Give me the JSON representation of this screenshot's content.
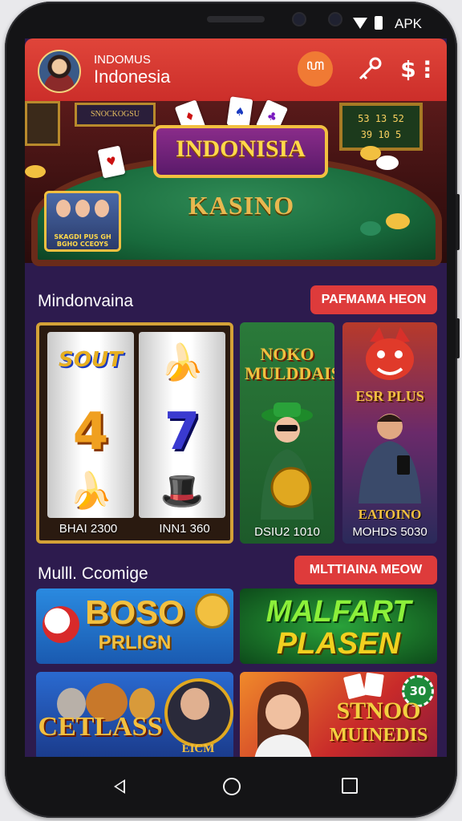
{
  "status_bar": {
    "label": "APK"
  },
  "header": {
    "brand_top": "INDOMUS",
    "brand_bottom": "Indonesia",
    "lang_icon": "ꦲ",
    "key_icon": "key-icon",
    "money_icon": "$⋮"
  },
  "banner": {
    "title": "INDONISIA",
    "subtitle": "KASINO",
    "sign_text": "SNOCKOGSU",
    "board_lines": [
      "53 13 52",
      "39 10 5"
    ],
    "thumb_caption": "SKAGDI PUS GH BGHO CCEOYS"
  },
  "section1": {
    "title": "Mindonvaina",
    "button": "PAFMAMA HEON",
    "tiles": [
      {
        "label": "BHAI 2300",
        "symbols": [
          "SOUT",
          "4",
          "🍌"
        ]
      },
      {
        "label": "INN1 360",
        "symbols": [
          "🍌",
          "7",
          "🎩"
        ]
      },
      {
        "label": "DSIU2 1010",
        "title": "NOKO MULDDAIS"
      },
      {
        "label": "MOHDS 5030",
        "title": "ESR PLUS",
        "subtitle": "EATOINO"
      }
    ]
  },
  "section2": {
    "title": "Mulll. Ccomige",
    "button": "MLTTIAINA MEOW",
    "banners": [
      {
        "line1": "BOSO",
        "line2": "PRLIGN"
      },
      {
        "line1": "MALFART",
        "line2": "PLASEN"
      },
      {
        "line1": "CETLASS",
        "line2": "EICM"
      },
      {
        "line1": "STNOO",
        "line2": "MUINEDIS",
        "badge": "30"
      }
    ]
  },
  "colors": {
    "header": "#cc2e2a",
    "screen_bg": "#2d1b4e",
    "accent_button": "#de3b3b",
    "gold": "#f2c040"
  }
}
